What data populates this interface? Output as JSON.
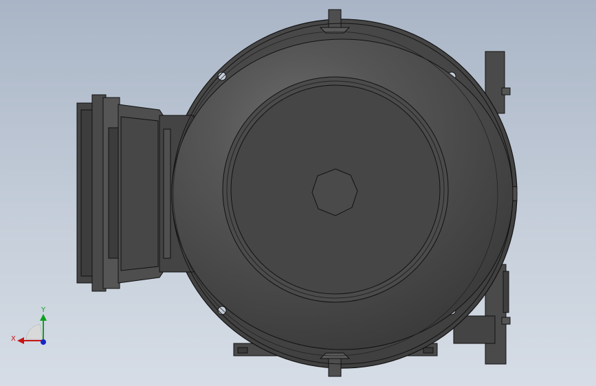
{
  "triad": {
    "x_label": "X",
    "y_label": "Y",
    "x_color": "#c81414",
    "y_color": "#10a020",
    "z_color": "#1428c8"
  },
  "colors": {
    "background_top": "#a9b5c6",
    "background_bottom": "#d6dde6",
    "body_dark": "#3f3f3f",
    "body_mid": "#4a4a4a",
    "body_light": "#5a5a5a",
    "edge": "#111111"
  }
}
